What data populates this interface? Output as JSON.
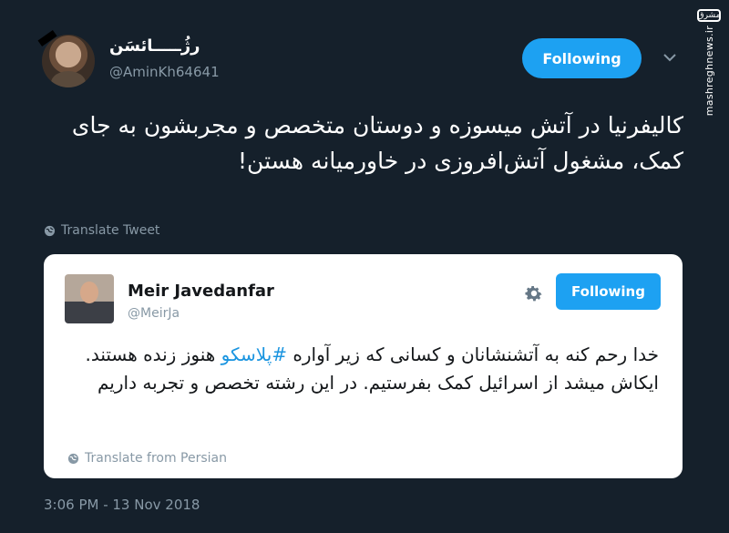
{
  "watermark": {
    "logo": "مشرق",
    "site": "mashreghnews.ir"
  },
  "author": {
    "display_name": "رژُـــــائسَن",
    "handle": "@AminKh64641",
    "follow_label": "Following"
  },
  "tweet": {
    "text": "کالیفرنیا در آتش میسوزه و دوستان متخصص و مجربشون به جای کمک، مشغول آتش‌افروزی در خاورمیانه هستن!",
    "translate_label": "Translate Tweet",
    "timestamp": "3:06 PM - 13 Nov 2018"
  },
  "quoted": {
    "display_name": "Meir Javedanfar",
    "handle": "@MeirJa",
    "follow_label": "Following",
    "text_before": "خدا رحم کنه به آتشنشانان و کسانی که زیر آواره ",
    "hashtag": "#پلاسکو",
    "text_after": " هنوز زنده هستند. ایکاش میشد از اسرائیل کمک بفرستیم. در این رشته تخصص و تجربه داریم",
    "translate_label": "Translate from Persian"
  },
  "icons": [
    "globe-icon",
    "chevron-down-icon",
    "gear-icon"
  ],
  "colors": {
    "background": "#15202b",
    "accent": "#1da1f2",
    "muted": "#8899a6"
  }
}
